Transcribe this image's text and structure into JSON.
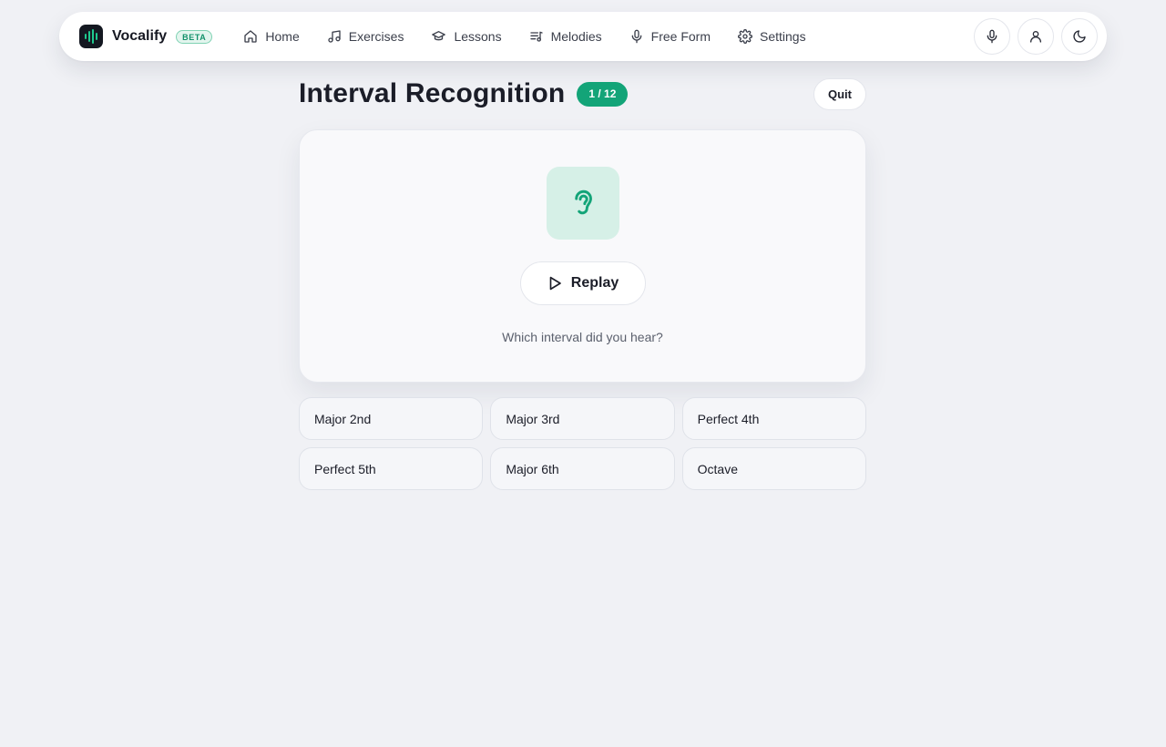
{
  "brand": {
    "name": "Vocalify",
    "badge": "BETA"
  },
  "nav": {
    "items": [
      {
        "label": "Home",
        "icon": "home-icon"
      },
      {
        "label": "Exercises",
        "icon": "music-note-icon"
      },
      {
        "label": "Lessons",
        "icon": "graduation-cap-icon"
      },
      {
        "label": "Melodies",
        "icon": "music-list-icon"
      },
      {
        "label": "Free Form",
        "icon": "microphone-icon"
      },
      {
        "label": "Settings",
        "icon": "gear-icon"
      }
    ],
    "actions": [
      "microphone-icon",
      "user-icon",
      "moon-icon"
    ]
  },
  "exercise": {
    "title": "Interval Recognition",
    "progress": "1 / 12",
    "quit_label": "Quit",
    "replay_label": "Replay",
    "prompt": "Which interval did you hear?",
    "options": [
      "Major 2nd",
      "Major 3rd",
      "Perfect 4th",
      "Perfect 5th",
      "Major 6th",
      "Octave"
    ]
  },
  "colors": {
    "accent": "#13a478",
    "background": "#f0f1f5",
    "card": "#f9f9fb",
    "ear_tile": "#d6f0e7"
  }
}
